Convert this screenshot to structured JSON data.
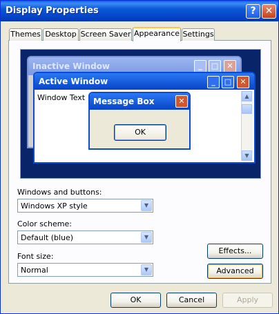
{
  "window": {
    "title": "Display Properties",
    "help_glyph": "?",
    "close_glyph": "✕"
  },
  "tabs": [
    {
      "label": "Themes"
    },
    {
      "label": "Desktop"
    },
    {
      "label": "Screen Saver"
    },
    {
      "label": "Appearance",
      "selected": true
    },
    {
      "label": "Settings"
    }
  ],
  "preview": {
    "inactive_title": "Inactive Window",
    "active_title": "Active Window",
    "window_text": "Window Text",
    "message_title": "Message Box",
    "message_ok": "OK",
    "min_glyph": "_",
    "max_glyph": "□",
    "close_glyph": "✕",
    "up_glyph": "▲",
    "down_glyph": "▼"
  },
  "settings": {
    "windows_buttons_label": "Windows and buttons:",
    "windows_buttons_value": "Windows XP style",
    "color_scheme_label": "Color scheme:",
    "color_scheme_value": "Default (blue)",
    "font_size_label": "Font size:",
    "font_size_value": "Normal",
    "dropdown_glyph": "▼"
  },
  "buttons": {
    "effects": "Effects...",
    "advanced": "Advanced",
    "ok": "OK",
    "cancel": "Cancel",
    "apply": "Apply"
  },
  "colors": {
    "title_blue": "#0b58d8",
    "dialog_bg": "#ece9d8",
    "preview_bg": "#0a246a"
  }
}
